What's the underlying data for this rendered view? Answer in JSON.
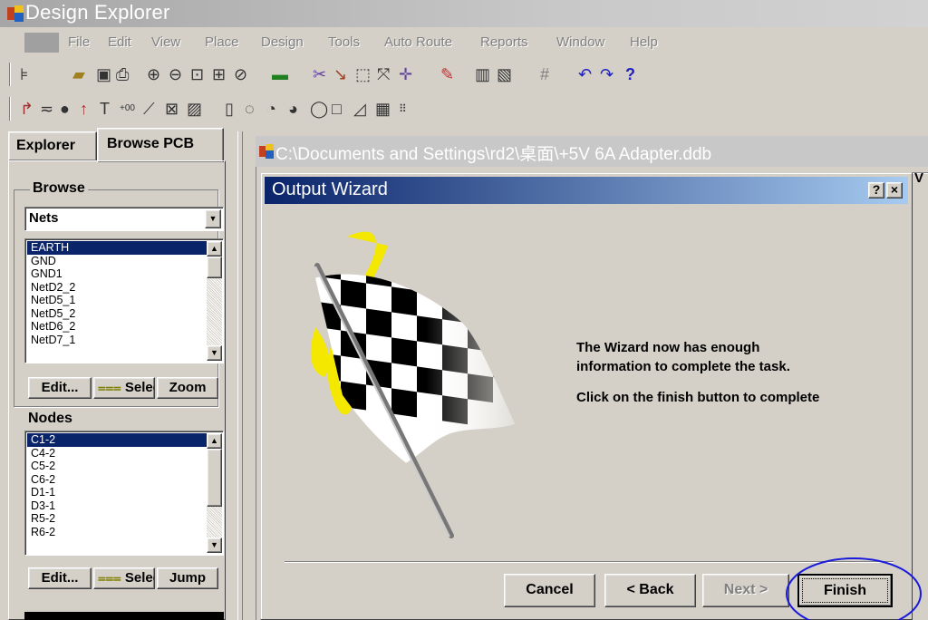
{
  "app": {
    "title": "Design Explorer"
  },
  "menu": [
    "File",
    "Edit",
    "View",
    "Place",
    "Design",
    "Tools",
    "Auto Route",
    "Reports",
    "Window",
    "Help"
  ],
  "left_panel": {
    "tabs": [
      "Explorer",
      "Browse PCB"
    ],
    "browse_label": "Browse",
    "browse_select": "Nets",
    "nets": [
      "EARTH",
      "GND",
      "GND1",
      "NetD2_2",
      "NetD5_1",
      "NetD5_2",
      "NetD6_2",
      "NetD7_1"
    ],
    "net_buttons": {
      "edit": "Edit...",
      "select": "Selec",
      "zoom": "Zoom"
    },
    "nodes_label": "Nodes",
    "nodes": [
      "C1-2",
      "C4-2",
      "C5-2",
      "C6-2",
      "D1-1",
      "D3-1",
      "R5-2",
      "R6-2"
    ],
    "node_buttons": {
      "edit": "Edit...",
      "select": "Selec",
      "jump": "Jump"
    }
  },
  "document": {
    "title": "C:\\Documents and Settings\\rd2\\桌面\\+5V 6A Adapter.ddb"
  },
  "wizard": {
    "title": "Output Wizard",
    "help_btn": "?",
    "close_btn": "×",
    "message_line1": "The Wizard now has enough",
    "message_line2": "information to complete the task.",
    "message_line3": "Click on the finish button to complete",
    "buttons": {
      "cancel": "Cancel",
      "back": "< Back",
      "next": "Next >",
      "finish": "Finish"
    }
  },
  "colors": {
    "highlight": "#0a246a",
    "annotation": "#1a1adc",
    "flag_yellow": "#f5e800"
  }
}
